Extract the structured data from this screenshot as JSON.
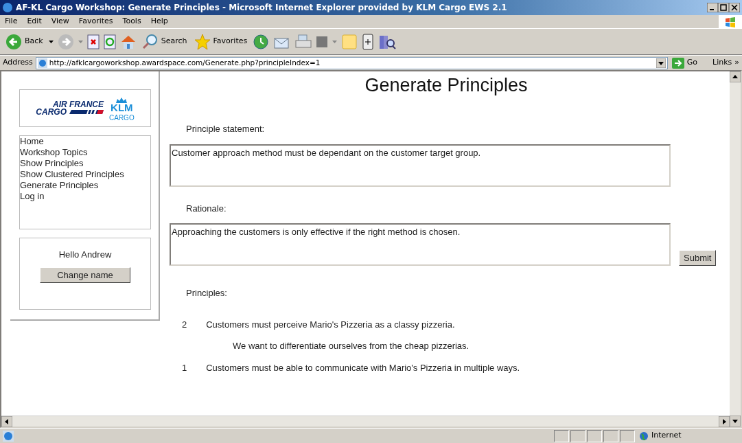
{
  "window": {
    "title": "AF-KL Cargo Workshop: Generate Principles - Microsoft Internet Explorer provided by KLM Cargo EWS 2.1"
  },
  "menu": [
    "File",
    "Edit",
    "View",
    "Favorites",
    "Tools",
    "Help"
  ],
  "toolbar": {
    "back": "Back",
    "search": "Search",
    "favorites": "Favorites"
  },
  "address_bar": {
    "label": "Address",
    "url": "http://afklcargoworkshop.awardspace.com/Generate.php?principleIndex=1",
    "go": "Go",
    "links": "Links",
    "more": "»"
  },
  "logo": {
    "air_france": "AIR FRANCE",
    "af_cargo": "CARGO",
    "klm": "KLM",
    "klm_cargo": "CARGO"
  },
  "nav": [
    "Home",
    "Workshop Topics",
    "Show Principles",
    "Show Clustered Principles",
    "Generate Principles",
    "Log in"
  ],
  "user_box": {
    "greeting": "Hello Andrew",
    "button": "Change name"
  },
  "page_title": "Generate Principles",
  "fields": [
    {
      "label": "Principle statement:",
      "value": "Customer approach method must be dependant on the customer target group."
    },
    {
      "label": "Rationale:",
      "value": "Approaching the customers is only effective if the right method is chosen."
    }
  ],
  "submit": "Submit",
  "principles_heading": "Principles:",
  "principles": [
    {
      "number": "2",
      "text": "Customers must perceive Mario's Pizzeria as a classy pizzeria.",
      "rationale": "We want to differentiate ourselves from the cheap pizzerias."
    },
    {
      "number": "1",
      "text": "Customers must be able to communicate with Mario's Pizzeria in multiple ways."
    }
  ],
  "status_bar": {
    "zone": "Internet"
  }
}
